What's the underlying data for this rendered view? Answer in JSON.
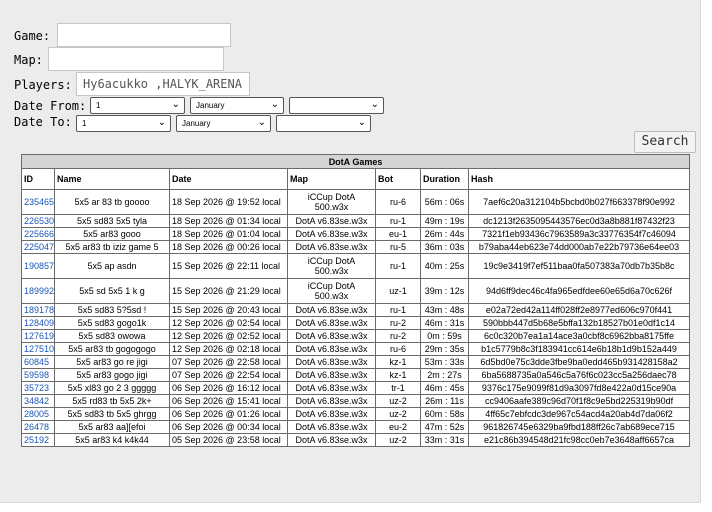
{
  "form": {
    "game_label": "Game:",
    "game_value": "",
    "map_label": "Map:",
    "map_value": "",
    "players_label": "Players:",
    "players_value": "Hy6acukko ,HALYK_ARENA",
    "date_from_label": "Date From:",
    "date_to_label": "Date To:",
    "from_day": "1",
    "from_month": "January",
    "from_year": "",
    "to_day": "1",
    "to_month": "January",
    "to_year": "",
    "search_label": "Search"
  },
  "table": {
    "caption": "DotA Games",
    "columns": [
      "ID",
      "Name",
      "Date",
      "Map",
      "Bot",
      "Duration",
      "Hash"
    ],
    "rows": [
      {
        "id": "235465",
        "name": "5x5 ar 83 tb goooo",
        "date": "18 Sep 2026 @ 19:52 local",
        "map": "iCCup DotA 500.w3x",
        "bot": "ru-6",
        "duration": "56m : 06s",
        "hash": "7aef6c20a312104b5bcbd0b027f663378f90e992"
      },
      {
        "id": "226530",
        "name": "5x5 sd83 5x5 tyla",
        "date": "18 Sep 2026 @ 01:34 local",
        "map": "DotA v6.83se.w3x",
        "bot": "ru-1",
        "duration": "49m : 19s",
        "hash": "dc1213f2635095443576ec0d3a8b881f87432f23"
      },
      {
        "id": "225666",
        "name": "5x5 ar83 gooo",
        "date": "18 Sep 2026 @ 01:04 local",
        "map": "DotA v6.83se.w3x",
        "bot": "eu-1",
        "duration": "26m : 44s",
        "hash": "7321f1eb93436c7963589a3c33776354f7c46094"
      },
      {
        "id": "225047",
        "name": "5x5 ar83 tb iziz game 5",
        "date": "18 Sep 2026 @ 00:26 local",
        "map": "DotA v6.83se.w3x",
        "bot": "ru-5",
        "duration": "36m : 03s",
        "hash": "b79aba44eb623e74dd000ab7e22b79736e64ee03"
      },
      {
        "id": "190857",
        "name": "5x5 ap asdn",
        "date": "15 Sep 2026 @ 22:11 local",
        "map": "iCCup DotA 500.w3x",
        "bot": "ru-1",
        "duration": "40m : 25s",
        "hash": "19c9e3419f7ef511baa0fa507383a70db7b35b8c"
      },
      {
        "id": "189992",
        "name": "5x5 sd 5x5 1 k g",
        "date": "15 Sep 2026 @ 21:29 local",
        "map": "iCCup DotA 500.w3x",
        "bot": "uz-1",
        "duration": "39m : 12s",
        "hash": "94d6ff9dec46c4fa965edfdee60e65d6a70c626f"
      },
      {
        "id": "189178",
        "name": "5x5 sd83 5?5sd !",
        "date": "15 Sep 2026 @ 20:43 local",
        "map": "DotA v6.83se.w3x",
        "bot": "ru-1",
        "duration": "43m : 48s",
        "hash": "e02a72ed42a114ff028ff2e8977ed606c970f441"
      },
      {
        "id": "128409",
        "name": "5x5 sd83 gogo1k",
        "date": "12 Sep 2026 @ 02:54 local",
        "map": "DotA v6.83se.w3x",
        "bot": "ru-2",
        "duration": "46m : 31s",
        "hash": "590bbb447d5b68e5bffa132b18527b01e0df1c14"
      },
      {
        "id": "127619",
        "name": "5x5 sd83 owowa",
        "date": "12 Sep 2026 @ 02:52 local",
        "map": "DotA v6.83se.w3x",
        "bot": "ru-2",
        "duration": "0m : 59s",
        "hash": "6c0c320b7ea1a14ace3a0cbf8c6962bba8175ffe"
      },
      {
        "id": "127510",
        "name": "5x5 ar83 tb gogogogo",
        "date": "12 Sep 2026 @ 02:18 local",
        "map": "DotA v6.83se.w3x",
        "bot": "ru-6",
        "duration": "29m : 35s",
        "hash": "b1c5779b8c3f183941cc614e6b18b1d9b152a449"
      },
      {
        "id": "60845",
        "name": "5x5 ar83 go re jigi",
        "date": "07 Sep 2026 @ 22:58 local",
        "map": "DotA v6.83se.w3x",
        "bot": "kz-1",
        "duration": "53m : 33s",
        "hash": "6d5bd0e75c3dde3fbe9ba0edd465b931428158a2"
      },
      {
        "id": "59598",
        "name": "5x5 ar83 gogo jigi",
        "date": "07 Sep 2026 @ 22:54 local",
        "map": "DotA v6.83se.w3x",
        "bot": "kz-1",
        "duration": "2m : 27s",
        "hash": "6ba5688735a0a546c5a76f6c023cc5a256daec78"
      },
      {
        "id": "35723",
        "name": "5x5 xl83 go 2 3 ggggg",
        "date": "06 Sep 2026 @ 16:12 local",
        "map": "DotA v6.83se.w3x",
        "bot": "tr-1",
        "duration": "46m : 45s",
        "hash": "9376c175e9099f81d9a3097fd8e422a0d15ce90a"
      },
      {
        "id": "34842",
        "name": "5x5 rd83 tb 5x5 2k+",
        "date": "06 Sep 2026 @ 15:41 local",
        "map": "DotA v6.83se.w3x",
        "bot": "uz-2",
        "duration": "26m : 11s",
        "hash": "cc9406aafe389c96d70f1f8c9e5bd225319b90df"
      },
      {
        "id": "28005",
        "name": "5x5 sd83 tb 5x5 ghrgg",
        "date": "06 Sep 2026 @ 01:26 local",
        "map": "DotA v6.83se.w3x",
        "bot": "uz-2",
        "duration": "60m : 58s",
        "hash": "4ff65c7ebfcdc3de967c54acd4a20ab4d7da06f2"
      },
      {
        "id": "26478",
        "name": "5x5 ar83 aa][efoi",
        "date": "06 Sep 2026 @ 00:34 local",
        "map": "DotA v6.83se.w3x",
        "bot": "eu-2",
        "duration": "47m : 52s",
        "hash": "961826745e6329ba9fbd188ff26c7ab689ece715"
      },
      {
        "id": "25192",
        "name": "5x5 ar83 k4 k4k44",
        "date": "05 Sep 2026 @ 23:58 local",
        "map": "DotA v6.83se.w3x",
        "bot": "uz-2",
        "duration": "33m : 31s",
        "hash": "e21c86b394548d21fc98cc0eb7e3648aff6657ca"
      }
    ]
  },
  "colors": {
    "link": "#1a56b8",
    "background": "#ececec",
    "caption_bg": "#d4d4d4"
  },
  "icons": {
    "select_arrow": "chevron-down-icon"
  }
}
